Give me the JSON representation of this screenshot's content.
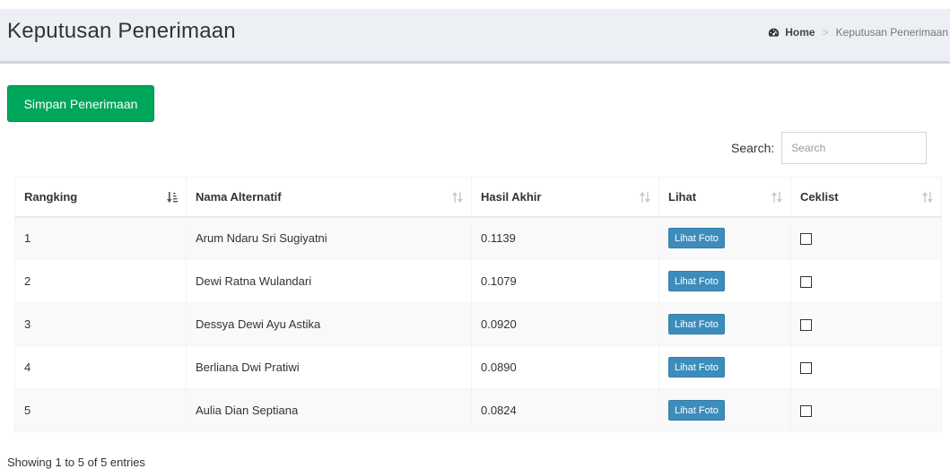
{
  "header": {
    "title": "Keputusan Penerimaan",
    "breadcrumb": {
      "home": "Home",
      "current": "Keputusan Penerimaan"
    }
  },
  "actions": {
    "save_label": "Simpan Penerimaan"
  },
  "search": {
    "label": "Search:",
    "placeholder": "Search"
  },
  "table": {
    "columns": [
      "Rangking",
      "Nama Alternatif",
      "Hasil Akhir",
      "Lihat",
      "Ceklist"
    ],
    "rows": [
      {
        "rank": "1",
        "name": "Arum Ndaru Sri Sugiyatni",
        "score": "0.1139",
        "action": "Lihat Foto"
      },
      {
        "rank": "2",
        "name": "Dewi Ratna Wulandari",
        "score": "0.1079",
        "action": "Lihat Foto"
      },
      {
        "rank": "3",
        "name": "Dessya Dewi Ayu Astika",
        "score": "0.0920",
        "action": "Lihat Foto"
      },
      {
        "rank": "4",
        "name": "Berliana Dwi Pratiwi",
        "score": "0.0890",
        "action": "Lihat Foto"
      },
      {
        "rank": "5",
        "name": "Aulia Dian Septiana",
        "score": "0.0824",
        "action": "Lihat Foto"
      }
    ]
  },
  "footer": {
    "info": "Showing 1 to 5 of 5 entries"
  },
  "colors": {
    "success": "#00a65a",
    "primary": "#3c8dbc",
    "header_bg": "#ecf0f5"
  }
}
